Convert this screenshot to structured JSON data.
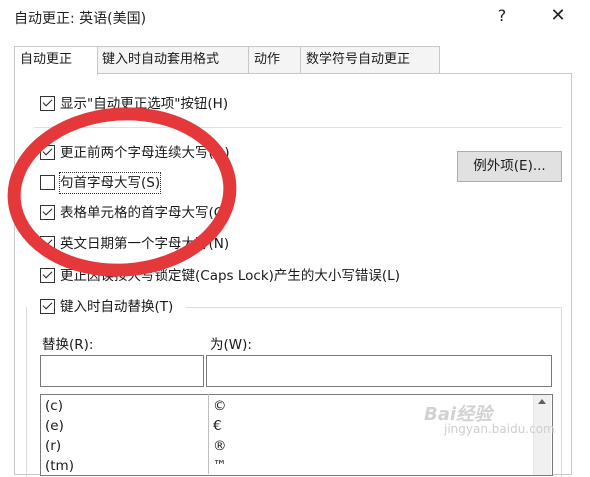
{
  "window": {
    "title": "自动更正: 英语(美国)",
    "help": "?",
    "close": "✕"
  },
  "tabs": [
    {
      "label": "自动更正",
      "active": true
    },
    {
      "label": "键入时自动套用格式",
      "active": false
    },
    {
      "label": "动作",
      "active": false
    },
    {
      "label": "数学符号自动更正",
      "active": false
    }
  ],
  "options": {
    "show_buttons": {
      "label": "显示\"自动更正选项\"按钮(H)",
      "checked": true
    },
    "two_initials": {
      "label": "更正前两个字母连续大写(O)",
      "checked": true
    },
    "sentence_first": {
      "label": "句首字母大写(S)",
      "checked": false
    },
    "table_first": {
      "label": "表格单元格的首字母大写(C)",
      "checked": true
    },
    "day_names": {
      "label": "英文日期第一个字母大写(N)",
      "checked": true
    },
    "caps_lock": {
      "label": "更正因误按大写锁定键(Caps Lock)产生的大小写错误(L)",
      "checked": true
    },
    "replace_typing": {
      "label": "键入时自动替换(T)",
      "checked": true
    }
  },
  "exceptions_button": "例外项(E)...",
  "replace": {
    "replace_label": "替换(R):",
    "with_label": "为(W):",
    "replace_value": "",
    "with_value": "",
    "rows": [
      {
        "from": "(c)",
        "to": "©"
      },
      {
        "from": "(e)",
        "to": "€"
      },
      {
        "from": "(r)",
        "to": "®"
      },
      {
        "from": "(tm)",
        "to": "™"
      }
    ]
  },
  "highlight_color": "#e5383b",
  "watermark": {
    "logo": "Bai经验",
    "url": "jingyan.baidu.com"
  }
}
